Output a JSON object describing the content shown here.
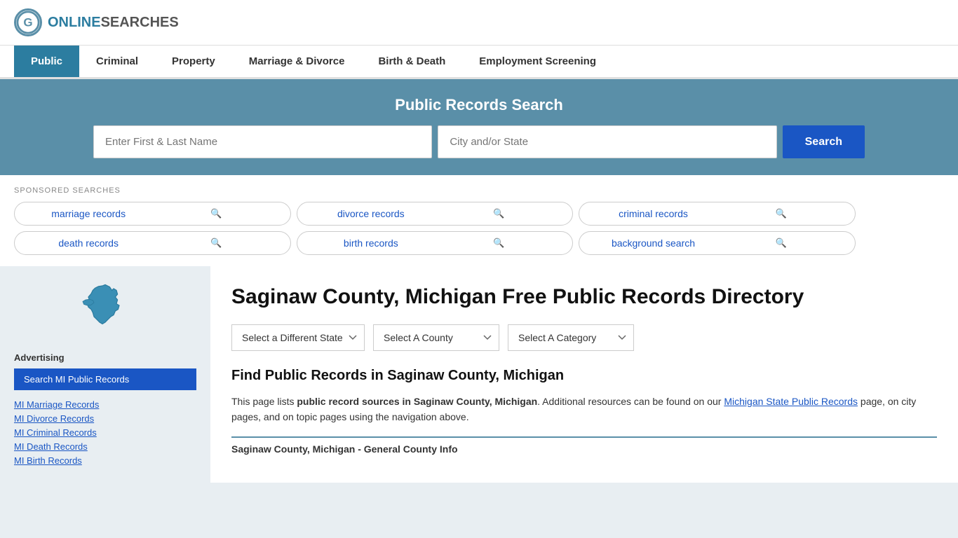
{
  "site": {
    "logo_letter": "G",
    "logo_online": "ONLINE",
    "logo_searches": "SEARCHES"
  },
  "nav": {
    "items": [
      {
        "label": "Public",
        "active": true
      },
      {
        "label": "Criminal",
        "active": false
      },
      {
        "label": "Property",
        "active": false
      },
      {
        "label": "Marriage & Divorce",
        "active": false
      },
      {
        "label": "Birth & Death",
        "active": false
      },
      {
        "label": "Employment Screening",
        "active": false
      }
    ]
  },
  "search_banner": {
    "title": "Public Records Search",
    "name_placeholder": "Enter First & Last Name",
    "location_placeholder": "City and/or State",
    "button_label": "Search"
  },
  "sponsored": {
    "label": "SPONSORED SEARCHES",
    "pills": [
      {
        "text": "marriage records"
      },
      {
        "text": "divorce records"
      },
      {
        "text": "criminal records"
      },
      {
        "text": "death records"
      },
      {
        "text": "birth records"
      },
      {
        "text": "background search"
      }
    ]
  },
  "page": {
    "title": "Saginaw County, Michigan Free Public Records Directory",
    "dropdowns": {
      "state_label": "Select a Different State",
      "county_label": "Select A County",
      "category_label": "Select A Category"
    },
    "find_title": "Find Public Records in Saginaw County, Michigan",
    "find_text_1": "This page lists ",
    "find_bold": "public record sources in Saginaw County, Michigan",
    "find_text_2": ". Additional resources can be found on our ",
    "find_link": "Michigan State Public Records",
    "find_text_3": " page, on city pages, and on topic pages using the navigation above.",
    "county_info_label": "Saginaw County, Michigan - General County Info"
  },
  "sidebar": {
    "ad_label": "Advertising",
    "ad_button": "Search MI Public Records",
    "links": [
      {
        "label": "MI Marriage Records"
      },
      {
        "label": "MI Divorce Records"
      },
      {
        "label": "MI Criminal Records"
      },
      {
        "label": "MI Death Records"
      },
      {
        "label": "MI Birth Records"
      }
    ]
  }
}
